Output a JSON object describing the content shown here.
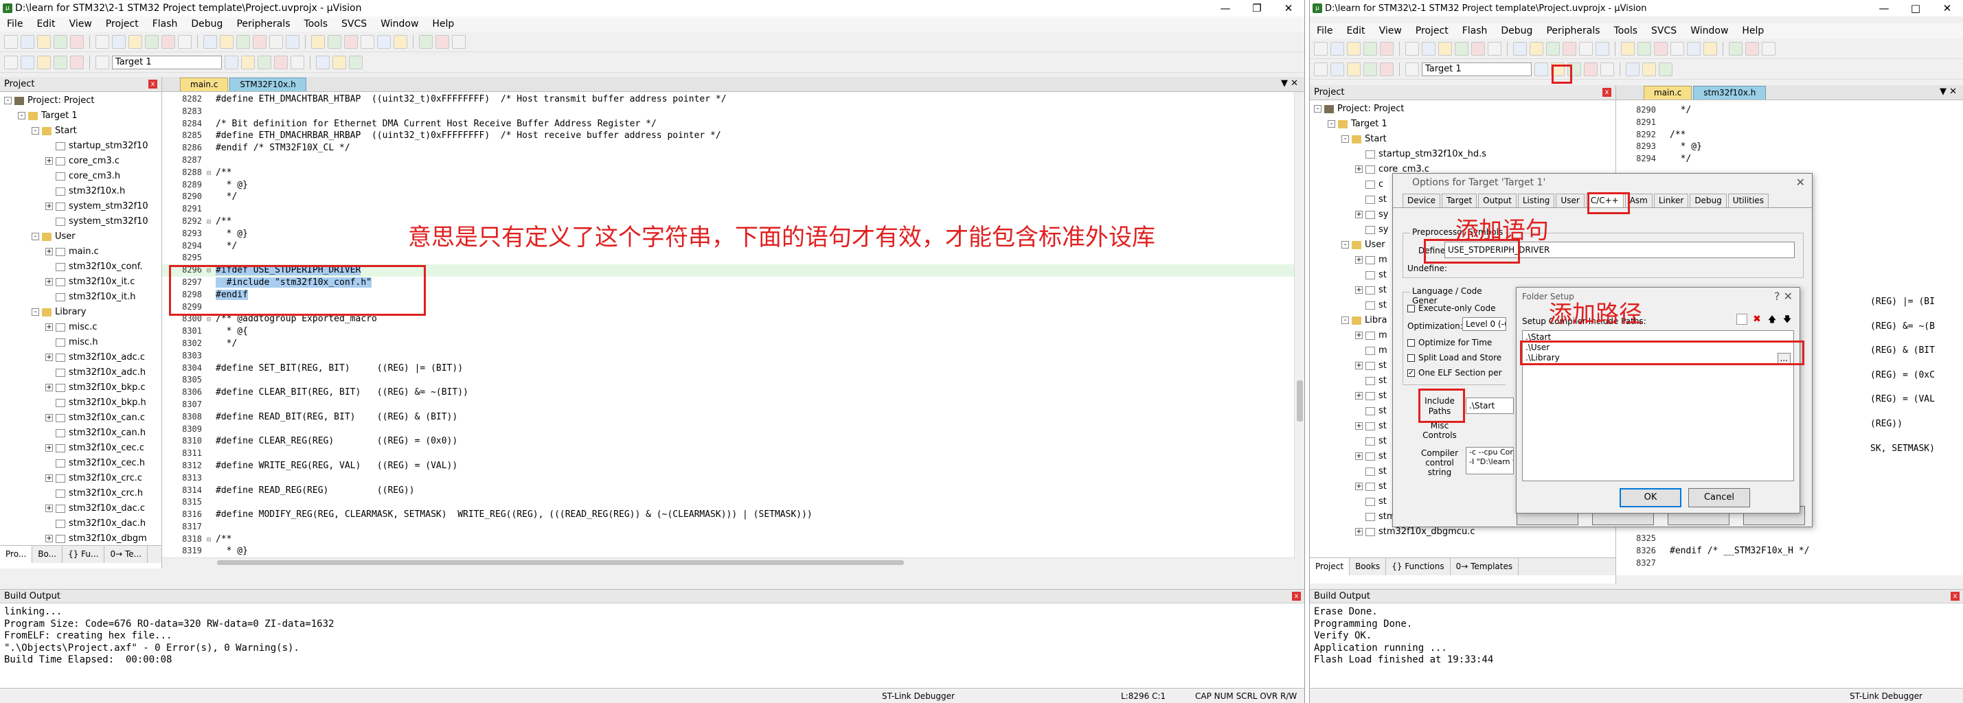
{
  "left": {
    "title": "D:\\learn for STM32\\2-1 STM32 Project template\\Project.uvprojx - µVision",
    "menu": [
      "File",
      "Edit",
      "View",
      "Project",
      "Flash",
      "Debug",
      "Peripherals",
      "Tools",
      "SVCS",
      "Window",
      "Help"
    ],
    "target": "Target 1",
    "project_pane_title": "Project",
    "tree": [
      {
        "label": "Project: Project",
        "level": 0,
        "type": "proj",
        "expand": "-"
      },
      {
        "label": "Target 1",
        "level": 1,
        "type": "folder",
        "expand": "-"
      },
      {
        "label": "Start",
        "level": 2,
        "type": "folder",
        "expand": "-"
      },
      {
        "label": "startup_stm32f10",
        "level": 3,
        "type": "file",
        "expand": ""
      },
      {
        "label": "core_cm3.c",
        "level": 3,
        "type": "file",
        "expand": "+"
      },
      {
        "label": "core_cm3.h",
        "level": 3,
        "type": "file",
        "expand": ""
      },
      {
        "label": "stm32f10x.h",
        "level": 3,
        "type": "file",
        "expand": ""
      },
      {
        "label": "system_stm32f10",
        "level": 3,
        "type": "file",
        "expand": "+"
      },
      {
        "label": "system_stm32f10",
        "level": 3,
        "type": "file",
        "expand": ""
      },
      {
        "label": "User",
        "level": 2,
        "type": "folder",
        "expand": "-"
      },
      {
        "label": "main.c",
        "level": 3,
        "type": "file",
        "expand": "+"
      },
      {
        "label": "stm32f10x_conf.",
        "level": 3,
        "type": "file",
        "expand": ""
      },
      {
        "label": "stm32f10x_it.c",
        "level": 3,
        "type": "file",
        "expand": "+"
      },
      {
        "label": "stm32f10x_it.h",
        "level": 3,
        "type": "file",
        "expand": ""
      },
      {
        "label": "Library",
        "level": 2,
        "type": "folder",
        "expand": "-"
      },
      {
        "label": "misc.c",
        "level": 3,
        "type": "file",
        "expand": "+"
      },
      {
        "label": "misc.h",
        "level": 3,
        "type": "file",
        "expand": ""
      },
      {
        "label": "stm32f10x_adc.c",
        "level": 3,
        "type": "file",
        "expand": "+"
      },
      {
        "label": "stm32f10x_adc.h",
        "level": 3,
        "type": "file",
        "expand": ""
      },
      {
        "label": "stm32f10x_bkp.c",
        "level": 3,
        "type": "file",
        "expand": "+"
      },
      {
        "label": "stm32f10x_bkp.h",
        "level": 3,
        "type": "file",
        "expand": ""
      },
      {
        "label": "stm32f10x_can.c",
        "level": 3,
        "type": "file",
        "expand": "+"
      },
      {
        "label": "stm32f10x_can.h",
        "level": 3,
        "type": "file",
        "expand": ""
      },
      {
        "label": "stm32f10x_cec.c",
        "level": 3,
        "type": "file",
        "expand": "+"
      },
      {
        "label": "stm32f10x_cec.h",
        "level": 3,
        "type": "file",
        "expand": ""
      },
      {
        "label": "stm32f10x_crc.c",
        "level": 3,
        "type": "file",
        "expand": "+"
      },
      {
        "label": "stm32f10x_crc.h",
        "level": 3,
        "type": "file",
        "expand": ""
      },
      {
        "label": "stm32f10x_dac.c",
        "level": 3,
        "type": "file",
        "expand": "+"
      },
      {
        "label": "stm32f10x_dac.h",
        "level": 3,
        "type": "file",
        "expand": ""
      },
      {
        "label": "stm32f10x_dbgm",
        "level": 3,
        "type": "file",
        "expand": "+"
      }
    ],
    "bottom_tabs": [
      "Pro...",
      "Bo...",
      "{} Fu...",
      "0→ Te..."
    ],
    "editor_tabs": [
      "main.c",
      "STM32F10x.h"
    ],
    "code": [
      {
        "n": "8282",
        "f": "",
        "t": "#define ETH_DMACHTBAR_HTBAP  ((uint32_t)0xFFFFFFFF)  /* Host transmit buffer address pointer */"
      },
      {
        "n": "8283",
        "f": "",
        "t": ""
      },
      {
        "n": "8284",
        "f": "",
        "t": "/* Bit definition for Ethernet DMA Current Host Receive Buffer Address Register */"
      },
      {
        "n": "8285",
        "f": "",
        "t": "#define ETH_DMACHRBAR_HRBAP  ((uint32_t)0xFFFFFFFF)  /* Host receive buffer address pointer */"
      },
      {
        "n": "8286",
        "f": "",
        "t": "#endif /* STM32F10X_CL */"
      },
      {
        "n": "8287",
        "f": "",
        "t": ""
      },
      {
        "n": "8288",
        "f": "⊟",
        "t": "/**"
      },
      {
        "n": "8289",
        "f": "",
        "t": "  * @}"
      },
      {
        "n": "8290",
        "f": "",
        "t": "  */"
      },
      {
        "n": "8291",
        "f": "",
        "t": ""
      },
      {
        "n": "8292",
        "f": "⊟",
        "t": "/**"
      },
      {
        "n": "8293",
        "f": "",
        "t": "  * @}"
      },
      {
        "n": "8294",
        "f": "",
        "t": "  */"
      },
      {
        "n": "8295",
        "f": "",
        "t": ""
      },
      {
        "n": "8296",
        "f": "⊟",
        "t": "#ifdef USE_STDPERIPH_DRIVER"
      },
      {
        "n": "8297",
        "f": "",
        "t": "  #include \"stm32f10x_conf.h\""
      },
      {
        "n": "8298",
        "f": "",
        "t": "#endif"
      },
      {
        "n": "8299",
        "f": "",
        "t": ""
      },
      {
        "n": "8300",
        "f": "⊟",
        "t": "/** @addtogroup Exported_macro"
      },
      {
        "n": "8301",
        "f": "",
        "t": "  * @{"
      },
      {
        "n": "8302",
        "f": "",
        "t": "  */"
      },
      {
        "n": "8303",
        "f": "",
        "t": ""
      },
      {
        "n": "8304",
        "f": "",
        "t": "#define SET_BIT(REG, BIT)     ((REG) |= (BIT))"
      },
      {
        "n": "8305",
        "f": "",
        "t": ""
      },
      {
        "n": "8306",
        "f": "",
        "t": "#define CLEAR_BIT(REG, BIT)   ((REG) &= ~(BIT))"
      },
      {
        "n": "8307",
        "f": "",
        "t": ""
      },
      {
        "n": "8308",
        "f": "",
        "t": "#define READ_BIT(REG, BIT)    ((REG) & (BIT))"
      },
      {
        "n": "8309",
        "f": "",
        "t": ""
      },
      {
        "n": "8310",
        "f": "",
        "t": "#define CLEAR_REG(REG)        ((REG) = (0x0))"
      },
      {
        "n": "8311",
        "f": "",
        "t": ""
      },
      {
        "n": "8312",
        "f": "",
        "t": "#define WRITE_REG(REG, VAL)   ((REG) = (VAL))"
      },
      {
        "n": "8313",
        "f": "",
        "t": ""
      },
      {
        "n": "8314",
        "f": "",
        "t": "#define READ_REG(REG)         ((REG))"
      },
      {
        "n": "8315",
        "f": "",
        "t": ""
      },
      {
        "n": "8316",
        "f": "",
        "t": "#define MODIFY_REG(REG, CLEARMASK, SETMASK)  WRITE_REG((REG), (((READ_REG(REG)) & (~(CLEARMASK))) | (SETMASK)))"
      },
      {
        "n": "8317",
        "f": "",
        "t": ""
      },
      {
        "n": "8318",
        "f": "⊟",
        "t": "/**"
      },
      {
        "n": "8319",
        "f": "",
        "t": "  * @}"
      },
      {
        "n": "8320",
        "f": "",
        "t": "  */"
      }
    ],
    "annotation": "意思是只有定义了这个字符串，下面的语句才有效，才能包含标准外设库",
    "build_title": "Build Output",
    "build_lines": "linking...\nProgram Size: Code=676 RO-data=320 RW-data=0 ZI-data=1632\nFromELF: creating hex file...\n\".\\Objects\\Project.axf\" - 0 Error(s), 0 Warning(s).\nBuild Time Elapsed:  00:00:08",
    "status_debugger": "ST-Link Debugger",
    "status_pos": "L:8296 C:1",
    "status_flags": "CAP  NUM  SCRL  OVR  R/W"
  },
  "right": {
    "title": "D:\\learn for STM32\\2-1 STM32 Project template\\Project.uvprojx - µVision",
    "menu": [
      "File",
      "Edit",
      "View",
      "Project",
      "Flash",
      "Debug",
      "Peripherals",
      "Tools",
      "SVCS",
      "Window",
      "Help"
    ],
    "target": "Target 1",
    "project_pane_title": "Project",
    "tree": [
      {
        "label": "Project: Project",
        "level": 0,
        "type": "proj",
        "expand": "-"
      },
      {
        "label": "Target 1",
        "level": 1,
        "type": "folder",
        "expand": "-"
      },
      {
        "label": "Start",
        "level": 2,
        "type": "folder",
        "expand": "-"
      },
      {
        "label": "startup_stm32f10x_hd.s",
        "level": 3,
        "type": "file",
        "expand": ""
      },
      {
        "label": "core_cm3.c",
        "level": 3,
        "type": "file",
        "expand": "+"
      },
      {
        "label": "c",
        "level": 3,
        "type": "file",
        "expand": ""
      },
      {
        "label": "st",
        "level": 3,
        "type": "file",
        "expand": ""
      },
      {
        "label": "sy",
        "level": 3,
        "type": "file",
        "expand": "+"
      },
      {
        "label": "sy",
        "level": 3,
        "type": "file",
        "expand": ""
      },
      {
        "label": "User",
        "level": 2,
        "type": "folder",
        "expand": "-"
      },
      {
        "label": "m",
        "level": 3,
        "type": "file",
        "expand": "+"
      },
      {
        "label": "st",
        "level": 3,
        "type": "file",
        "expand": ""
      },
      {
        "label": "st",
        "level": 3,
        "type": "file",
        "expand": "+"
      },
      {
        "label": "st",
        "level": 3,
        "type": "file",
        "expand": ""
      },
      {
        "label": "Libra",
        "level": 2,
        "type": "folder",
        "expand": "-"
      },
      {
        "label": "m",
        "level": 3,
        "type": "file",
        "expand": "+"
      },
      {
        "label": "m",
        "level": 3,
        "type": "file",
        "expand": ""
      },
      {
        "label": "st",
        "level": 3,
        "type": "file",
        "expand": "+"
      },
      {
        "label": "st",
        "level": 3,
        "type": "file",
        "expand": ""
      },
      {
        "label": "st",
        "level": 3,
        "type": "file",
        "expand": "+"
      },
      {
        "label": "st",
        "level": 3,
        "type": "file",
        "expand": ""
      },
      {
        "label": "st",
        "level": 3,
        "type": "file",
        "expand": "+"
      },
      {
        "label": "st",
        "level": 3,
        "type": "file",
        "expand": ""
      },
      {
        "label": "st",
        "level": 3,
        "type": "file",
        "expand": "+"
      },
      {
        "label": "st",
        "level": 3,
        "type": "file",
        "expand": ""
      },
      {
        "label": "st",
        "level": 3,
        "type": "file",
        "expand": "+"
      },
      {
        "label": "st",
        "level": 3,
        "type": "file",
        "expand": ""
      },
      {
        "label": "stm32f10x_dac.h",
        "level": 3,
        "type": "file",
        "expand": ""
      },
      {
        "label": "stm32f10x_dbgmcu.c",
        "level": 3,
        "type": "file",
        "expand": "+"
      }
    ],
    "bottom_tabs": [
      "Project",
      "Books",
      "{} Functions",
      "0→ Templates"
    ],
    "editor_tabs": [
      "main.c",
      "stm32f10x.h"
    ],
    "code": [
      {
        "n": "8290",
        "t": "  */"
      },
      {
        "n": "8291",
        "t": ""
      },
      {
        "n": "8292",
        "t": "/**"
      },
      {
        "n": "8293",
        "t": "  * @}"
      },
      {
        "n": "8294",
        "t": "  */"
      }
    ],
    "code_right_bits": [
      "(REG) |= (BI",
      "(REG) &= ~(B",
      "(REG) & (BIT",
      "(REG) = (0xC",
      "(REG) = (VAL",
      "(REG))",
      "SK, SETMASK)"
    ],
    "code_bottom": [
      {
        "n": "8325",
        "t": ""
      },
      {
        "n": "8326",
        "t": "#endif /* __STM32F10x_H */"
      },
      {
        "n": "8327",
        "t": ""
      }
    ],
    "build_title": "Build Output",
    "build_lines": "Erase Done.\nProgramming Done.\nVerify OK.\nApplication running ...\nFlash Load finished at 19:33:44",
    "status_debugger": "ST-Link Debugger",
    "options_dialog": {
      "title": "Options for Target 'Target 1'",
      "tabs": [
        "Device",
        "Target",
        "Output",
        "Listing",
        "User",
        "C/C++",
        "Asm",
        "Linker",
        "Debug",
        "Utilities"
      ],
      "active_tab": "C/C++",
      "preproc_label": "Preprocessor Symbols",
      "define_label": "Define:",
      "define_value": "USE_STDPERIPH_DRIVER",
      "undefine_label": "Undefine:",
      "lang_label": "Language / Code Gener",
      "exec_only": "Execute-only Code",
      "optimization_label": "Optimization:",
      "optimization_value": "Level 0 (-O",
      "opt_time": "Optimize for Time",
      "split_load": "Split Load and Store",
      "one_elf": "One ELF Section per",
      "include_paths": "Include\nPaths",
      "include_value": ".\\Start",
      "misc_controls": "Misc\nControls",
      "compiler_control": "Compiler\ncontrol\nstring",
      "compiler_value": "-c --cpu Corte\n-I \"D:\\learn f"
    },
    "folder_dialog": {
      "title": "Folder Setup",
      "setup_label": "Setup Compiler Include Paths:",
      "paths": [
        ".\\Start",
        ".\\User",
        ".\\Library"
      ],
      "browse": "...",
      "ok": "OK",
      "cancel": "Cancel"
    },
    "annot_define": "添加语句",
    "annot_path": "添加路径"
  }
}
